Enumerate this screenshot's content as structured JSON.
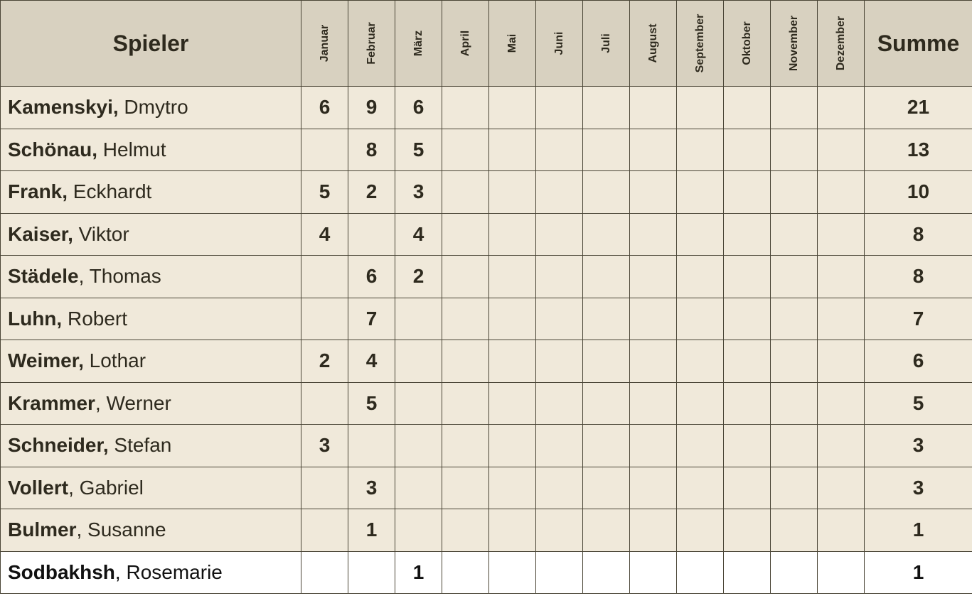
{
  "header": {
    "player_label": "Spieler",
    "sum_label": "Summe",
    "months": [
      "Januar",
      "Februar",
      "März",
      "April",
      "Mai",
      "Juni",
      "Juli",
      "August",
      "September",
      "Oktober",
      "November",
      "Dezember"
    ]
  },
  "players": [
    {
      "last": "Kamenskyi,",
      "first": " Dmytro",
      "scores": [
        "6",
        "9",
        "6",
        "",
        "",
        "",
        "",
        "",
        "",
        "",
        "",
        ""
      ],
      "sum": "21"
    },
    {
      "last": "Schönau,",
      "first": " Helmut",
      "scores": [
        "",
        "8",
        "5",
        "",
        "",
        "",
        "",
        "",
        "",
        "",
        "",
        ""
      ],
      "sum": "13"
    },
    {
      "last": "Frank,",
      "first": " Eckhardt",
      "scores": [
        "5",
        "2",
        "3",
        "",
        "",
        "",
        "",
        "",
        "",
        "",
        "",
        ""
      ],
      "sum": "10"
    },
    {
      "last": "Kaiser,",
      "first": " Viktor",
      "scores": [
        "4",
        "",
        "4",
        "",
        "",
        "",
        "",
        "",
        "",
        "",
        "",
        ""
      ],
      "sum": "8"
    },
    {
      "last": "Städele",
      "first": ", Thomas",
      "scores": [
        "",
        "6",
        "2",
        "",
        "",
        "",
        "",
        "",
        "",
        "",
        "",
        ""
      ],
      "sum": "8"
    },
    {
      "last": "Luhn,",
      "first": " Robert",
      "scores": [
        "",
        "7",
        "",
        "",
        "",
        "",
        "",
        "",
        "",
        "",
        "",
        ""
      ],
      "sum": "7"
    },
    {
      "last": "Weimer,",
      "first": " Lothar",
      "scores": [
        "2",
        "4",
        "",
        "",
        "",
        "",
        "",
        "",
        "",
        "",
        "",
        ""
      ],
      "sum": "6"
    },
    {
      "last": "Krammer",
      "first": ", Werner",
      "scores": [
        "",
        "5",
        "",
        "",
        "",
        "",
        "",
        "",
        "",
        "",
        "",
        ""
      ],
      "sum": "5"
    },
    {
      "last": "Schneider,",
      "first": " Stefan",
      "scores": [
        "3",
        "",
        "",
        "",
        "",
        "",
        "",
        "",
        "",
        "",
        "",
        ""
      ],
      "sum": "3"
    },
    {
      "last": "Vollert",
      "first": ", Gabriel",
      "scores": [
        "",
        "3",
        "",
        "",
        "",
        "",
        "",
        "",
        "",
        "",
        "",
        ""
      ],
      "sum": "3"
    },
    {
      "last": "Bulmer",
      "first": ", Susanne",
      "scores": [
        "",
        "1",
        "",
        "",
        "",
        "",
        "",
        "",
        "",
        "",
        "",
        ""
      ],
      "sum": "1"
    },
    {
      "last": "Sodbakhsh",
      "first": ", Rosemarie",
      "scores": [
        "",
        "",
        "1",
        "",
        "",
        "",
        "",
        "",
        "",
        "",
        "",
        ""
      ],
      "sum": "1",
      "highlight": "white"
    }
  ]
}
